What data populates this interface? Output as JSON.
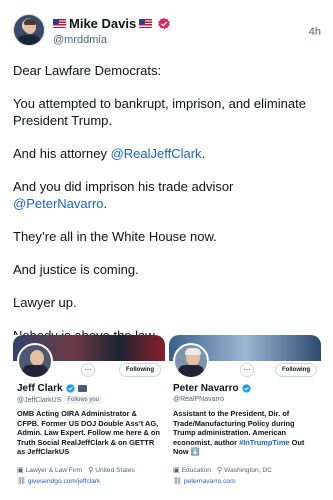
{
  "post": {
    "author_name": "Mike Davis",
    "author_handle": "@mrddmia",
    "time": "4h",
    "paragraphs": {
      "p1": "Dear Lawfare Democrats:",
      "p2": "You attempted to bankrupt, imprison, and eliminate President Trump.",
      "p3_text": "And his attorney ",
      "p3_link": "@RealJeffClark",
      "p3_end": ".",
      "p4_text": "And you did imprison his trade advisor ",
      "p4_link": "@PeterNavarro",
      "p4_end": ".",
      "p5": "They’re all in the White House now.",
      "p6": "And justice is coming.",
      "p7": "Lawyer up.",
      "p8": "Nobody is above the law."
    }
  },
  "cards": {
    "jeff": {
      "name": "Jeff Clark",
      "handle": "@JeffClarkUS",
      "follows_you": "Follows you",
      "following_label": "Following",
      "bio": "OMB Acting OIRA Administrator & CFPB. Former US DOJ Double Ass’t AG, Admin. Law Expert. Follow me here & on Truth Social RealJeffClark & on GETTR as JeffClarkUS",
      "category": "Lawyer & Law Firm",
      "location": "United States",
      "link": "givesendgo.com/jeffclark"
    },
    "peter": {
      "name": "Peter Navarro",
      "handle": "@RealPNavarro",
      "following_label": "Following",
      "bio_text": "Assistant to the President, Dir. of Trade/Manufacturing Policy during Trump administration. American economist, author ",
      "bio_hashtag": "#InTrumpTime",
      "bio_end": " Out Now ⬇️",
      "category": "Education",
      "location": "Washington, DC",
      "link": "peternavarro.com"
    }
  },
  "colors": {
    "link": "#1d62c9",
    "verified_blue": "#1d9bf0",
    "verified_pink": "#e0245e",
    "muted_text": "#536471"
  }
}
